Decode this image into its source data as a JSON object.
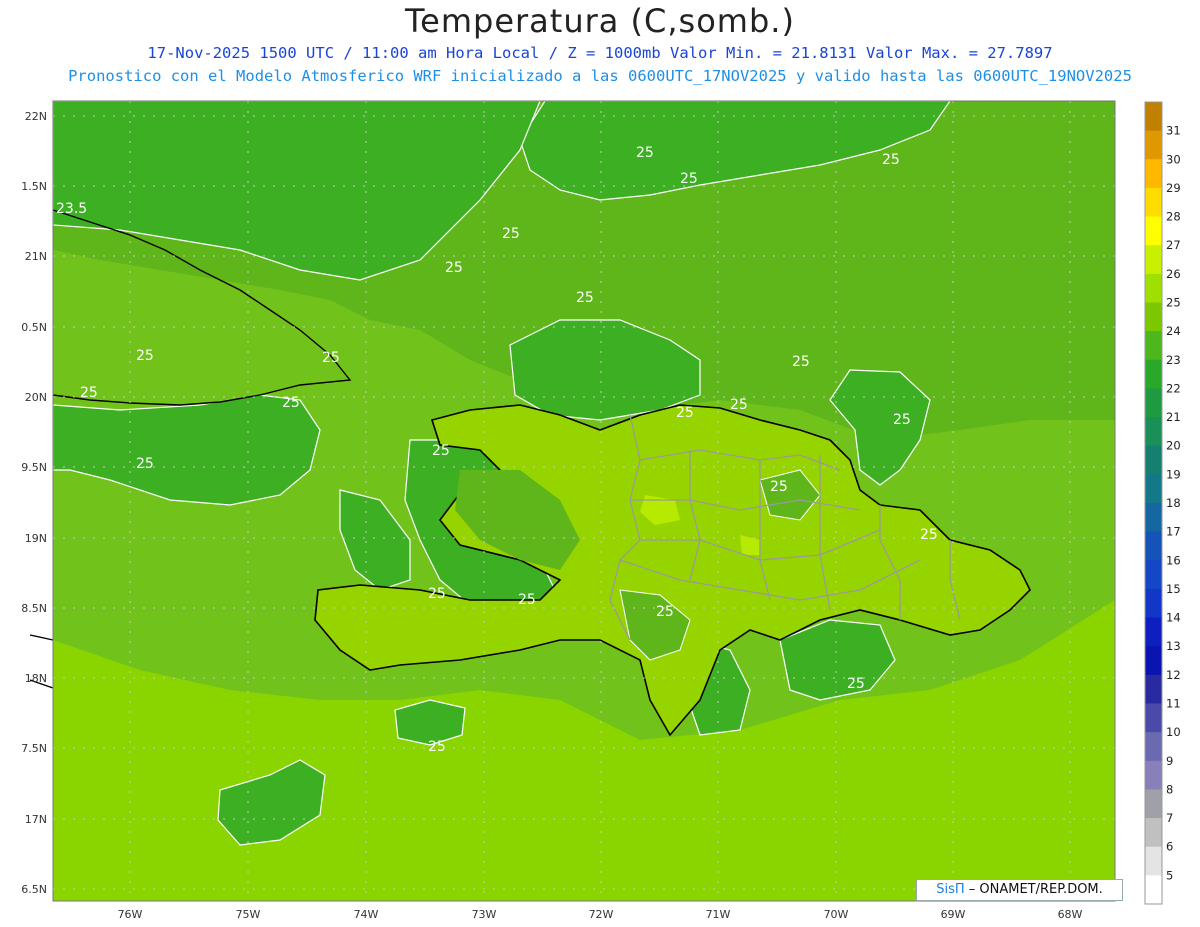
{
  "title": "Temperatura (C,somb.)",
  "subtitle_line1": "17-Nov-2025 1500 UTC / 11:00 am Hora Local / Z = 1000mb  Valor Min. = 21.8131  Valor Max. = 27.7897",
  "subtitle_line2": "Pronostico con el Modelo Atmosferico WRF inicializado a las 0600UTC_17NOV2025 y valido hasta las  0600UTC_19NOV2025",
  "credit": {
    "brand": "SisΠ",
    "text": "– ONAMET/REP.DOM."
  },
  "lat_labels": [
    "22N",
    "1.5N",
    "21N",
    "0.5N",
    "20N",
    "9.5N",
    "19N",
    "8.5N",
    "18N",
    "7.5N",
    "17N",
    "6.5N"
  ],
  "lon_labels": [
    "76W",
    "75W",
    "74W",
    "73W",
    "72W",
    "71W",
    "70W",
    "69W",
    "68W"
  ],
  "contour_labels": [
    "23.5",
    "25",
    "25",
    "25",
    "25",
    "25",
    "25",
    "25",
    "25",
    "25",
    "25",
    "25",
    "25",
    "25",
    "25",
    "25",
    "25",
    "25",
    "25",
    "25",
    "25",
    "25",
    "25",
    "25"
  ],
  "colorbar": {
    "levels": [
      "31",
      "30",
      "29",
      "28",
      "27",
      "26",
      "25",
      "24",
      "23",
      "22",
      "21",
      "20",
      "19",
      "18",
      "17",
      "16",
      "15",
      "14",
      "13",
      "12",
      "11",
      "10",
      "9",
      "8",
      "7",
      "6",
      "5"
    ],
    "colors": [
      "#c08000",
      "#e09800",
      "#ffb800",
      "#ffdd00",
      "#ffff00",
      "#c8f000",
      "#a0e000",
      "#7cc800",
      "#4cb81c",
      "#2aa82a",
      "#1e9b40",
      "#189058",
      "#157f70",
      "#137888",
      "#1467a0",
      "#1453b8",
      "#1446c8",
      "#1236c8",
      "#0d1fbf",
      "#0a14b0",
      "#2a2aa0",
      "#4a4aa8",
      "#6a6ab0",
      "#8880b8",
      "#a0a0a8",
      "#c0c0c0",
      "#e4e4e4",
      "#ffffff"
    ]
  },
  "colors": {
    "sea_far": "#8ad400",
    "sea_mid": "#72c21c",
    "warm_band": "#5fb61a",
    "cool_land": "#3caf22",
    "land_bright": "#96d400",
    "peak": "#b6ea00",
    "coast": "#000000",
    "border": "#9a9a9a",
    "contour": "#ffffff"
  }
}
